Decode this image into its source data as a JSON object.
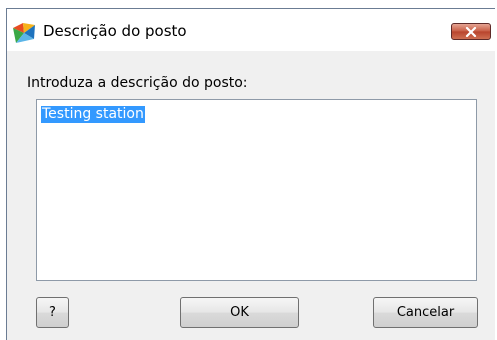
{
  "window": {
    "title": "Descrição do posto",
    "icon": "avg-logo-icon",
    "close_icon": "close-icon"
  },
  "form": {
    "prompt_label": "Introduza a descrição do posto:",
    "description_value": "Testing station"
  },
  "buttons": {
    "help_label": "?",
    "ok_label": "OK",
    "cancel_label": "Cancelar"
  },
  "colors": {
    "selection": "#3399ff",
    "close_button": "#c75b42"
  }
}
